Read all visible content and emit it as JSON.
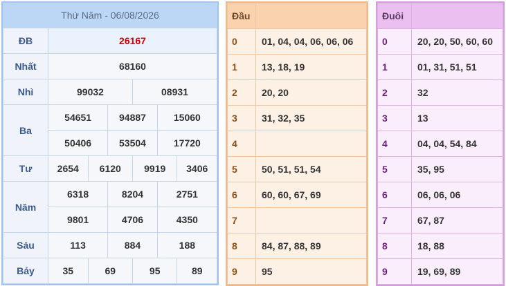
{
  "main": {
    "title": "Thứ Năm - 06/08/2026",
    "rows": {
      "db": {
        "label": "ĐB",
        "values": [
          "26167"
        ]
      },
      "nhat": {
        "label": "Nhất",
        "values": [
          "68160"
        ]
      },
      "nhi": {
        "label": "Nhì",
        "values": [
          "99032",
          "08931"
        ]
      },
      "ba": {
        "label": "Ba",
        "values": [
          "54651",
          "94887",
          "15060",
          "50406",
          "53504",
          "17720"
        ]
      },
      "tu": {
        "label": "Tư",
        "values": [
          "2654",
          "6120",
          "9919",
          "3406"
        ]
      },
      "nam": {
        "label": "Năm",
        "values": [
          "6318",
          "8204",
          "2751",
          "9801",
          "4706",
          "4350"
        ]
      },
      "sau": {
        "label": "Sáu",
        "values": [
          "113",
          "884",
          "188"
        ]
      },
      "bay": {
        "label": "Bảy",
        "values": [
          "35",
          "69",
          "95",
          "89"
        ]
      }
    }
  },
  "dau": {
    "header": "Đầu",
    "rows": [
      {
        "k": "0",
        "v": "01, 04, 04, 06, 06, 06"
      },
      {
        "k": "1",
        "v": "13, 18, 19"
      },
      {
        "k": "2",
        "v": "20, 20"
      },
      {
        "k": "3",
        "v": "31, 32, 35"
      },
      {
        "k": "4",
        "v": ""
      },
      {
        "k": "5",
        "v": "50, 51, 51, 54"
      },
      {
        "k": "6",
        "v": "60, 60, 67, 69"
      },
      {
        "k": "7",
        "v": ""
      },
      {
        "k": "8",
        "v": "84, 87, 88, 89"
      },
      {
        "k": "9",
        "v": "95"
      }
    ]
  },
  "duoi": {
    "header": "Đuôi",
    "rows": [
      {
        "k": "0",
        "v": "20, 20, 50, 60, 60"
      },
      {
        "k": "1",
        "v": "01, 31, 51, 51"
      },
      {
        "k": "2",
        "v": "32"
      },
      {
        "k": "3",
        "v": "13"
      },
      {
        "k": "4",
        "v": "04, 04, 54, 84"
      },
      {
        "k": "5",
        "v": "35, 95"
      },
      {
        "k": "6",
        "v": "06, 06, 06"
      },
      {
        "k": "7",
        "v": "67, 87"
      },
      {
        "k": "8",
        "v": "18, 88"
      },
      {
        "k": "9",
        "v": "19, 69, 89"
      }
    ]
  }
}
